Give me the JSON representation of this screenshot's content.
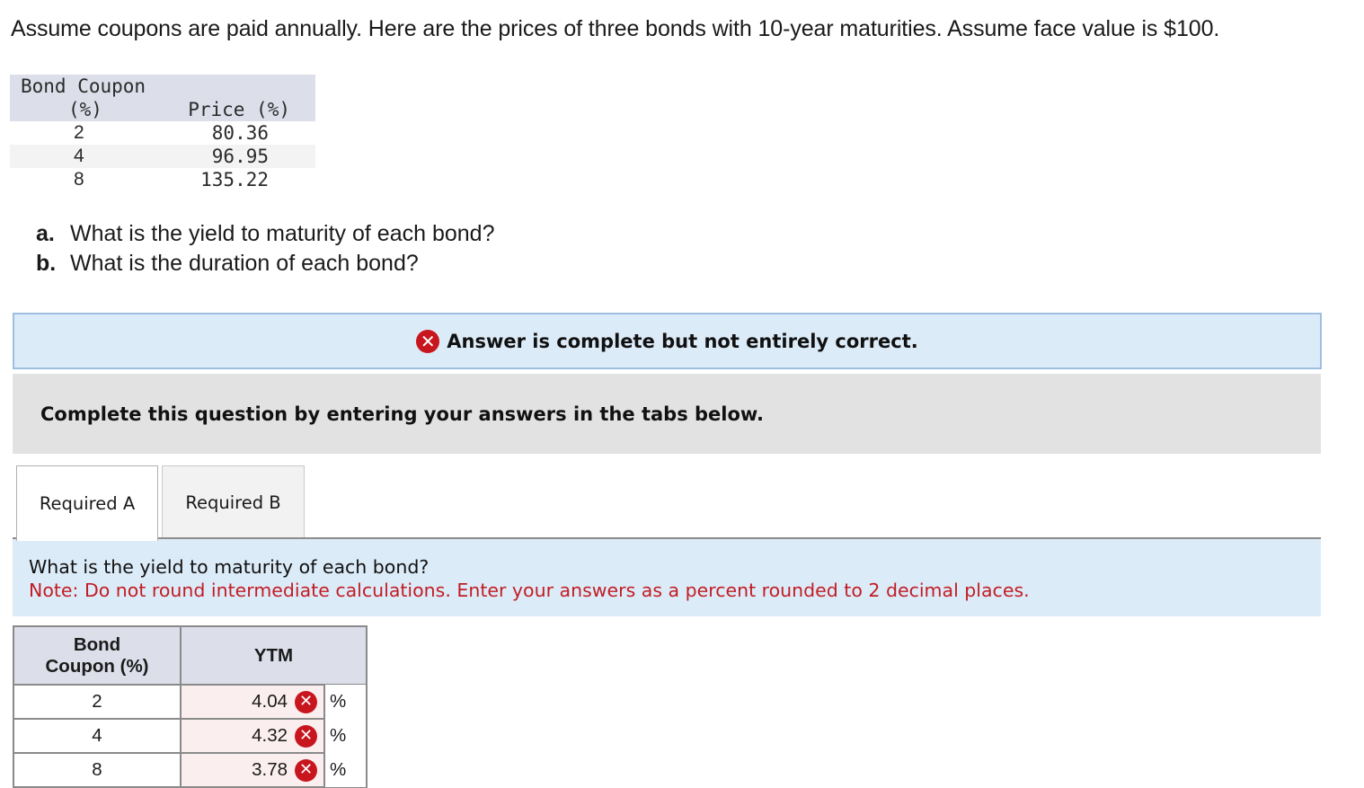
{
  "intro": "Assume coupons are paid annually. Here are the prices of three bonds with 10-year maturities. Assume face value is $100.",
  "bond_table": {
    "header_coupon_line1": "Bond Coupon",
    "header_coupon_line2": "(%)",
    "header_price": "Price (%)",
    "rows": [
      {
        "coupon": "2",
        "price": "80.36"
      },
      {
        "coupon": "4",
        "price": "96.95"
      },
      {
        "coupon": "8",
        "price": "135.22"
      }
    ]
  },
  "questions": [
    {
      "letter": "a.",
      "text": "What is the yield to maturity of each bond?"
    },
    {
      "letter": "b.",
      "text": "What is the duration of each bond?"
    }
  ],
  "banner": {
    "icon": "x-circle-icon",
    "text": "Answer is complete but not entirely correct."
  },
  "instruction": "Complete this question by entering your answers in the tabs below.",
  "tabs": [
    {
      "label": "Required A",
      "active": true
    },
    {
      "label": "Required B",
      "active": false
    }
  ],
  "panel": {
    "question": "What is the yield to maturity of each bond?",
    "note": "Note: Do not round intermediate calculations. Enter your answers as a percent rounded to 2 decimal places."
  },
  "answer_table": {
    "header_bond": "Bond Coupon (%)",
    "header_ytm": "YTM",
    "rows": [
      {
        "coupon": "2",
        "ytm": "4.04",
        "unit": "%",
        "status": "incorrect"
      },
      {
        "coupon": "4",
        "ytm": "4.32",
        "unit": "%",
        "status": "incorrect"
      },
      {
        "coupon": "8",
        "ytm": "3.78",
        "unit": "%",
        "status": "incorrect"
      }
    ]
  },
  "colors": {
    "error_red": "#c8161e",
    "banner_bg": "#dcebf8",
    "header_bg": "#dcdfea",
    "note_red": "#c21d24"
  }
}
